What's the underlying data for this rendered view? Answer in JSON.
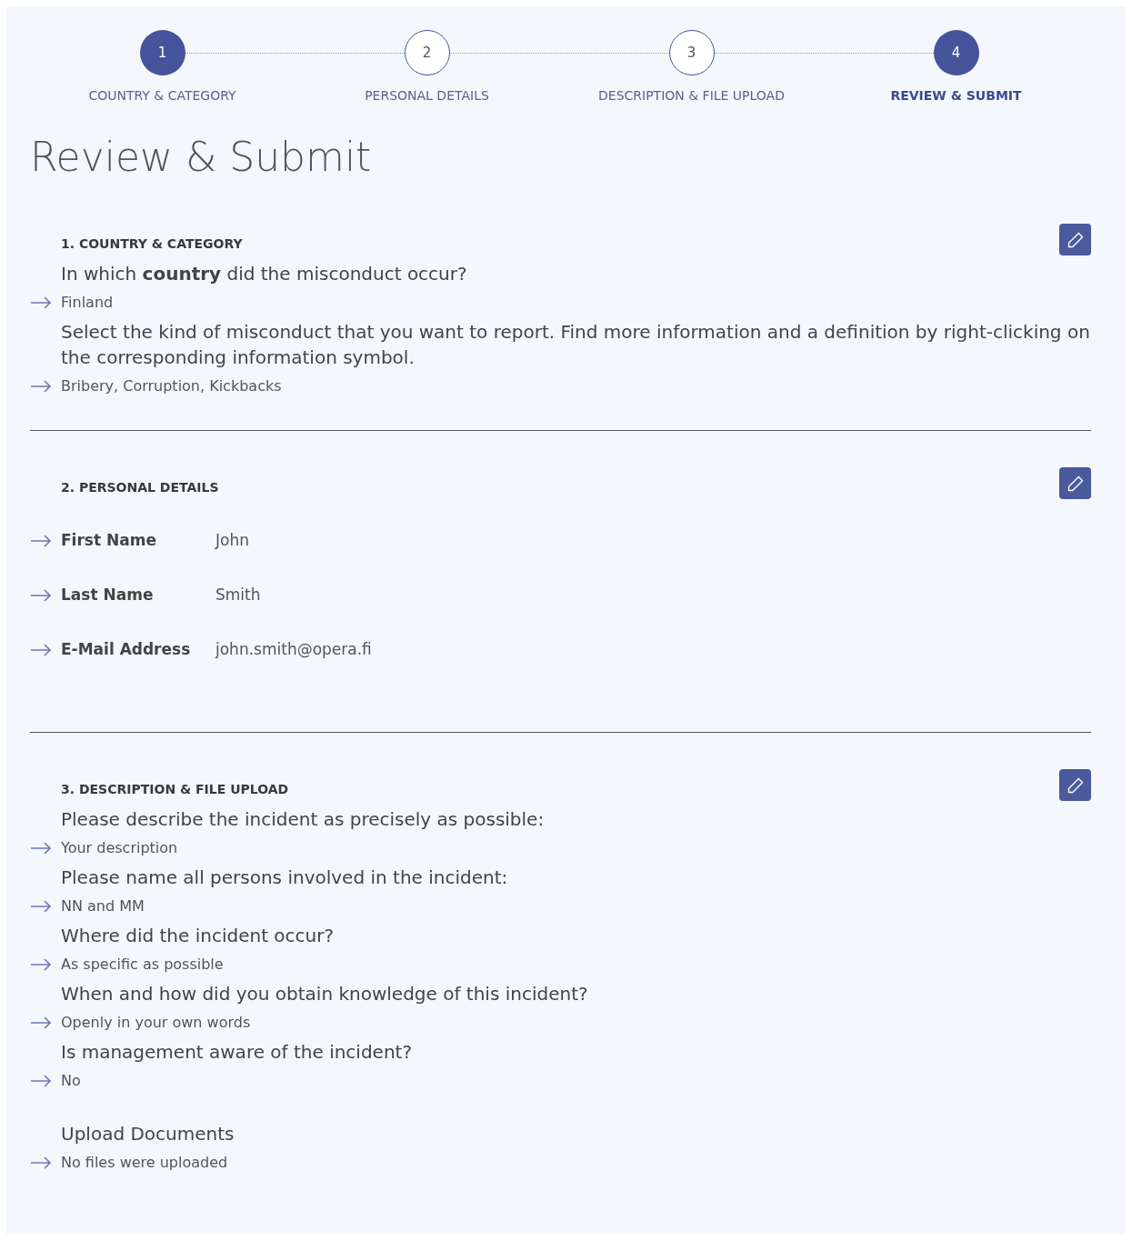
{
  "steps": [
    {
      "number": "1",
      "label": "COUNTRY & CATEGORY",
      "done": true,
      "selected": false
    },
    {
      "number": "2",
      "label": "PERSONAL DETAILS",
      "done": false,
      "selected": false
    },
    {
      "number": "3",
      "label": "DESCRIPTION & FILE UPLOAD",
      "done": false,
      "selected": false
    },
    {
      "number": "4",
      "label": "REVIEW & SUBMIT",
      "done": true,
      "selected": true
    }
  ],
  "title": "Review & Submit",
  "sections": [
    {
      "heading": "1. COUNTRY & CATEGORY",
      "kind": "qa",
      "items": [
        {
          "question": "In which **country** did the misconduct occur?",
          "answer": "Finland"
        },
        {
          "question": "Select the kind of misconduct that you want to report. Find more information and a definition by right-clicking on the corresponding information symbol.",
          "answer": "Bribery, Corruption, Kickbacks"
        }
      ]
    },
    {
      "heading": "2. PERSONAL DETAILS",
      "kind": "fields",
      "items": [
        {
          "label": "First Name",
          "value": "John"
        },
        {
          "label": "Last Name",
          "value": "Smith"
        },
        {
          "label": "E-Mail Address",
          "value": "john.smith@opera.fi"
        }
      ]
    },
    {
      "heading": "3. DESCRIPTION & FILE UPLOAD",
      "kind": "qa",
      "items": [
        {
          "question": "Please describe the incident as precisely as possible:",
          "answer": "Your description"
        },
        {
          "question": "Please name all persons involved in the incident:",
          "answer": "NN and MM"
        },
        {
          "question": "Where did the incident occur?",
          "answer": "As specific as possible"
        },
        {
          "question": "When and how did you obtain knowledge of this incident?",
          "answer": "Openly in your own words"
        },
        {
          "question": "Is management aware of the incident?",
          "answer": "No"
        }
      ],
      "upload": {
        "title": "Upload Documents",
        "answer": "No files were uploaded"
      }
    }
  ]
}
